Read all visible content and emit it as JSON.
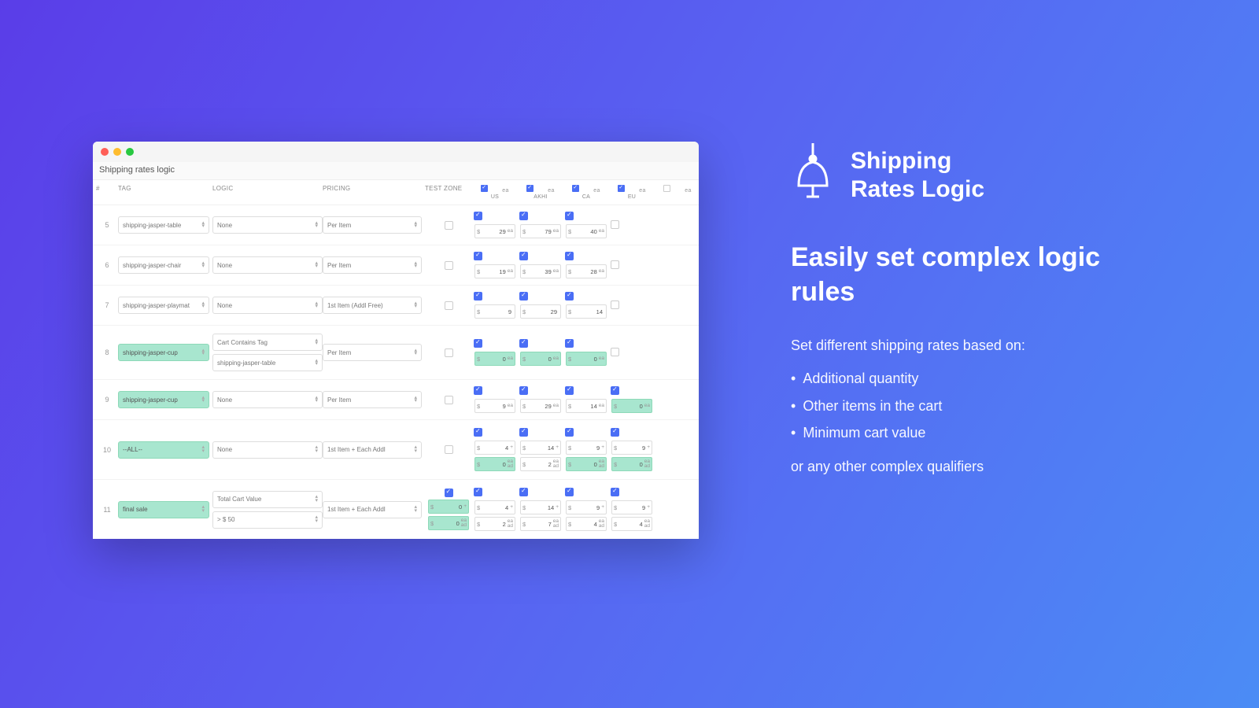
{
  "window": {
    "title": "Shipping rates logic",
    "headers": {
      "num": "#",
      "tag": "TAG",
      "logic": "LOGIC",
      "pricing": "PRICING",
      "test": "TEST ZONE"
    },
    "zones": [
      {
        "label": "US",
        "checked": true,
        "ea": "ea"
      },
      {
        "label": "AKHI",
        "checked": true,
        "ea": "ea"
      },
      {
        "label": "CA",
        "checked": true,
        "ea": "ea"
      },
      {
        "label": "EU",
        "checked": true,
        "ea": "ea"
      },
      {
        "label": "",
        "checked": false,
        "ea": "ea"
      }
    ],
    "rows": [
      {
        "n": "5",
        "tag": "shipping-jasper-table",
        "tagGreen": false,
        "logic": [
          "None"
        ],
        "logicGreen": false,
        "pricing": "Per Item",
        "test": {
          "show": true,
          "checked": false
        },
        "prices": [
          {
            "checked": true,
            "boxes": [
              {
                "cur": "$",
                "val": "29",
                "unit": "ea",
                "green": false
              }
            ]
          },
          {
            "checked": true,
            "boxes": [
              {
                "cur": "$",
                "val": "79",
                "unit": "ea",
                "green": false
              }
            ]
          },
          {
            "checked": true,
            "boxes": [
              {
                "cur": "$",
                "val": "40",
                "unit": "ea",
                "green": false
              }
            ]
          },
          {
            "checked": false,
            "boxes": []
          },
          {
            "checked": null,
            "boxes": []
          }
        ]
      },
      {
        "n": "6",
        "tag": "shipping-jasper-chair",
        "tagGreen": false,
        "logic": [
          "None"
        ],
        "logicGreen": false,
        "pricing": "Per Item",
        "test": {
          "show": true,
          "checked": false
        },
        "prices": [
          {
            "checked": true,
            "boxes": [
              {
                "cur": "$",
                "val": "19",
                "unit": "ea",
                "green": false
              }
            ]
          },
          {
            "checked": true,
            "boxes": [
              {
                "cur": "$",
                "val": "39",
                "unit": "ea",
                "green": false
              }
            ]
          },
          {
            "checked": true,
            "boxes": [
              {
                "cur": "$",
                "val": "28",
                "unit": "ea",
                "green": false
              }
            ]
          },
          {
            "checked": false,
            "boxes": []
          },
          {
            "checked": null,
            "boxes": []
          }
        ]
      },
      {
        "n": "7",
        "tag": "shipping-jasper-playmat",
        "tagGreen": false,
        "logic": [
          "None"
        ],
        "logicGreen": false,
        "pricing": "1st Item (Addl Free)",
        "test": {
          "show": true,
          "checked": false
        },
        "prices": [
          {
            "checked": true,
            "boxes": [
              {
                "cur": "$",
                "val": "9",
                "unit": "",
                "green": false
              }
            ]
          },
          {
            "checked": true,
            "boxes": [
              {
                "cur": "$",
                "val": "29",
                "unit": "",
                "green": false
              }
            ]
          },
          {
            "checked": true,
            "boxes": [
              {
                "cur": "$",
                "val": "14",
                "unit": "",
                "green": false
              }
            ]
          },
          {
            "checked": false,
            "boxes": []
          },
          {
            "checked": null,
            "boxes": []
          }
        ]
      },
      {
        "n": "8",
        "tag": "shipping-jasper-cup",
        "tagGreen": true,
        "logic": [
          "Cart Contains Tag",
          "shipping-jasper-table"
        ],
        "logicGreen": false,
        "pricing": "Per Item",
        "test": {
          "show": true,
          "checked": false
        },
        "prices": [
          {
            "checked": true,
            "boxes": [
              {
                "cur": "$",
                "val": "0",
                "unit": "ea",
                "green": true
              }
            ]
          },
          {
            "checked": true,
            "boxes": [
              {
                "cur": "$",
                "val": "0",
                "unit": "ea",
                "green": true
              }
            ]
          },
          {
            "checked": true,
            "boxes": [
              {
                "cur": "$",
                "val": "0",
                "unit": "ea",
                "green": true
              }
            ]
          },
          {
            "checked": false,
            "boxes": []
          },
          {
            "checked": null,
            "boxes": []
          }
        ]
      },
      {
        "n": "9",
        "tag": "shipping-jasper-cup",
        "tagGreen": true,
        "logic": [
          "None"
        ],
        "logicGreen": false,
        "pricing": "Per Item",
        "test": {
          "show": true,
          "checked": false
        },
        "prices": [
          {
            "checked": true,
            "boxes": [
              {
                "cur": "$",
                "val": "9",
                "unit": "ea",
                "green": false
              }
            ]
          },
          {
            "checked": true,
            "boxes": [
              {
                "cur": "$",
                "val": "29",
                "unit": "ea",
                "green": false
              }
            ]
          },
          {
            "checked": true,
            "boxes": [
              {
                "cur": "$",
                "val": "14",
                "unit": "ea",
                "green": false
              }
            ]
          },
          {
            "checked": true,
            "boxes": [
              {
                "cur": "$",
                "val": "0",
                "unit": "ea",
                "green": true
              }
            ]
          },
          {
            "checked": null,
            "boxes": []
          }
        ]
      },
      {
        "n": "10",
        "tag": "--ALL--",
        "tagGreen": true,
        "logic": [
          "None"
        ],
        "logicGreen": false,
        "pricing": "1st Item + Each Addl",
        "test": {
          "show": true,
          "checked": false
        },
        "prices": [
          {
            "checked": true,
            "boxes": [
              {
                "cur": "$",
                "val": "4",
                "unit": "+",
                "green": false
              },
              {
                "cur": "$",
                "val": "0",
                "unit": "ea ad",
                "green": true,
                "stack": true
              }
            ]
          },
          {
            "checked": true,
            "boxes": [
              {
                "cur": "$",
                "val": "14",
                "unit": "+",
                "green": false
              },
              {
                "cur": "$",
                "val": "2",
                "unit": "ea ad",
                "green": false,
                "stack": true
              }
            ]
          },
          {
            "checked": true,
            "boxes": [
              {
                "cur": "$",
                "val": "9",
                "unit": "+",
                "green": false
              },
              {
                "cur": "$",
                "val": "0",
                "unit": "ea ad",
                "green": true,
                "stack": true
              }
            ]
          },
          {
            "checked": true,
            "boxes": [
              {
                "cur": "$",
                "val": "9",
                "unit": "+",
                "green": false
              },
              {
                "cur": "$",
                "val": "0",
                "unit": "ea ad",
                "green": true,
                "stack": true
              }
            ]
          },
          {
            "checked": null,
            "boxes": []
          }
        ]
      },
      {
        "n": "11",
        "tag": "final sale",
        "tagGreen": true,
        "logic": [
          "Total Cart Value",
          "> $                         50"
        ],
        "logicGreen": false,
        "pricing": "1st Item + Each Addl",
        "test": {
          "show": true,
          "checked": true,
          "boxes": [
            {
              "cur": "$",
              "val": "0",
              "unit": "+",
              "green": true
            },
            {
              "cur": "$",
              "val": "0",
              "unit": "ea ad",
              "green": true,
              "stack": true
            }
          ]
        },
        "prices": [
          {
            "checked": true,
            "boxes": [
              {
                "cur": "$",
                "val": "4",
                "unit": "+",
                "green": false
              },
              {
                "cur": "$",
                "val": "2",
                "unit": "ea ad",
                "green": false,
                "stack": true
              }
            ]
          },
          {
            "checked": true,
            "boxes": [
              {
                "cur": "$",
                "val": "14",
                "unit": "+",
                "green": false
              },
              {
                "cur": "$",
                "val": "7",
                "unit": "ea ad",
                "green": false,
                "stack": true
              }
            ]
          },
          {
            "checked": true,
            "boxes": [
              {
                "cur": "$",
                "val": "9",
                "unit": "+",
                "green": false
              },
              {
                "cur": "$",
                "val": "4",
                "unit": "ea ad",
                "green": false,
                "stack": true
              }
            ]
          },
          {
            "checked": true,
            "boxes": [
              {
                "cur": "$",
                "val": "9",
                "unit": "+",
                "green": false
              },
              {
                "cur": "$",
                "val": "4",
                "unit": "ea ad",
                "green": false,
                "stack": true
              }
            ]
          },
          {
            "checked": null,
            "boxes": []
          }
        ]
      }
    ]
  },
  "panel": {
    "brand": "Shipping Rates Logic",
    "headline": "Easily set complex logic rules",
    "sub": "Set different shipping rates based on:",
    "bullets": [
      "Additional quantity",
      "Other items in the cart",
      "Minimum cart value"
    ],
    "trail": "or any other complex qualifiers"
  }
}
